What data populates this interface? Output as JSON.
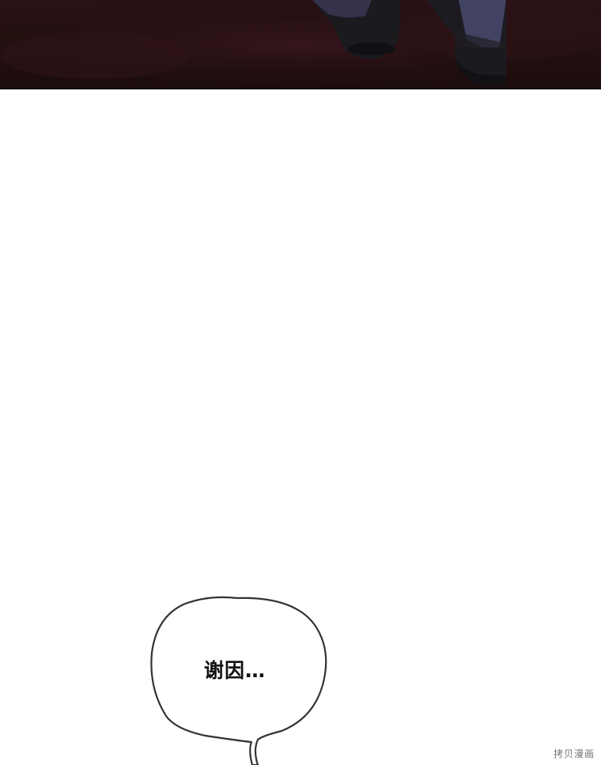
{
  "panel": {
    "top_scene": "dark-red-scene-with-boots"
  },
  "speech_bubble": {
    "text": "谢因…"
  },
  "watermark": {
    "text": "拷贝漫画"
  },
  "colors": {
    "background": "#ffffff",
    "scene_dark": "#24100f",
    "bubble_outline": "#333333"
  }
}
